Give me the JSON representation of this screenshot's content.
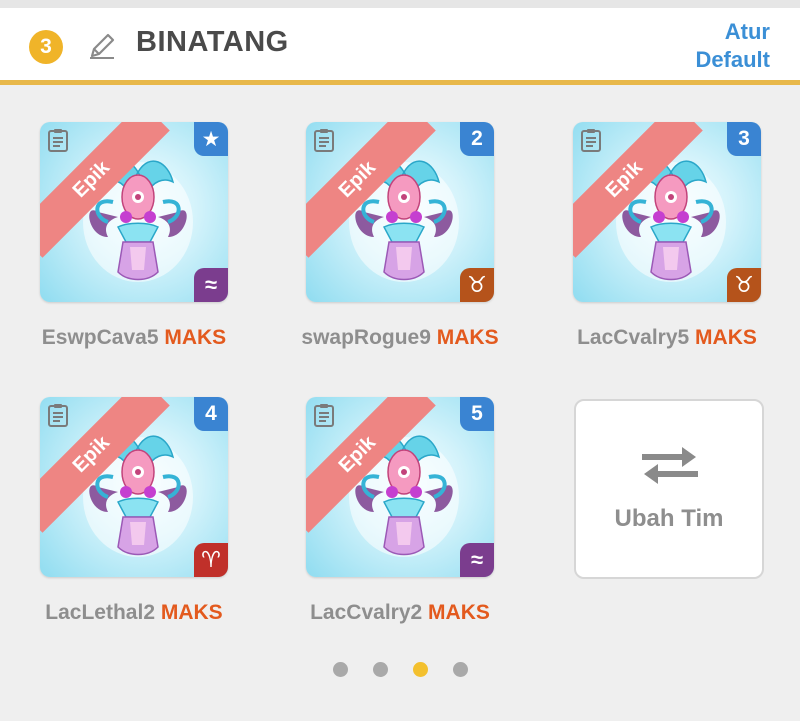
{
  "header": {
    "team_number": "3",
    "title": "BINATANG",
    "reset_line1": "Atur",
    "reset_line2": "Default"
  },
  "colors": {
    "accent": "#e8b84a",
    "rarity_ribbon": "#ee8583",
    "slot_badge": "#3a84d2",
    "max_text": "#e35a1e"
  },
  "monsters": [
    {
      "rarity": "Epik",
      "slot": "★",
      "element_symbol": "≈",
      "element_icon": "water-icon",
      "element_color": "#7b3d8e",
      "name": "EswpCava5",
      "level": "MAKS"
    },
    {
      "rarity": "Epik",
      "slot": "2",
      "element_symbol": "♉",
      "element_icon": "taurus-icon",
      "element_color": "#b5531b",
      "name": "swapRogue9",
      "level": "MAKS"
    },
    {
      "rarity": "Epik",
      "slot": "3",
      "element_symbol": "♉",
      "element_icon": "taurus-icon",
      "element_color": "#b5531b",
      "name": "LacCvalry5",
      "level": "MAKS"
    },
    {
      "rarity": "Epik",
      "slot": "4",
      "element_symbol": "♈",
      "element_icon": "aries-icon",
      "element_color": "#c0302a",
      "name": "LacLethal2",
      "level": "MAKS"
    },
    {
      "rarity": "Epik",
      "slot": "5",
      "element_symbol": "≈",
      "element_icon": "water-icon",
      "element_color": "#7b3d8e",
      "name": "LacCvalry2",
      "level": "MAKS"
    }
  ],
  "swap_button": {
    "label": "Ubah Tim"
  },
  "pagination": {
    "pages": 4,
    "current": 3
  }
}
